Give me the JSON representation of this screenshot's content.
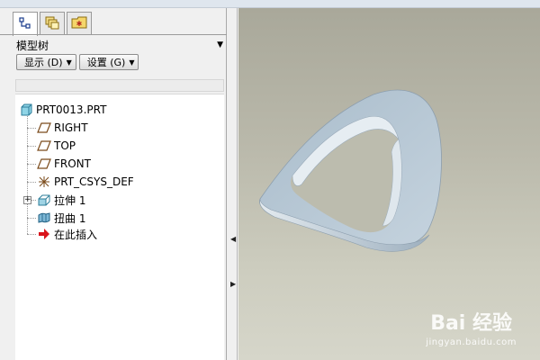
{
  "tabs": [
    {
      "icon": "model-tree-icon",
      "active": true
    },
    {
      "icon": "layers-icon",
      "active": false
    },
    {
      "icon": "favorites-folder-icon",
      "active": false
    }
  ],
  "panel": {
    "title": "模型树",
    "buttons": {
      "show": "显示 (D)",
      "settings": "设置 (G)"
    }
  },
  "tree": {
    "items": [
      {
        "label": "PRT0013.PRT",
        "icon": "part-icon"
      },
      {
        "label": "RIGHT",
        "icon": "datum-plane-icon"
      },
      {
        "label": "TOP",
        "icon": "datum-plane-icon"
      },
      {
        "label": "FRONT",
        "icon": "datum-plane-icon"
      },
      {
        "label": "PRT_CSYS_DEF",
        "icon": "coordinate-system-icon"
      },
      {
        "label": "拉伸 1",
        "icon": "extrude-icon",
        "expandable": true
      },
      {
        "label": "扭曲 1",
        "icon": "warp-icon"
      },
      {
        "label": "在此插入",
        "icon": "insert-here-arrow-icon"
      }
    ]
  },
  "watermark": {
    "brand": "Bai 经验",
    "url": "jingyan.baidu.com"
  },
  "colors": {
    "model_surface": "#b9c9d5",
    "viewport_top": "#a9a89a",
    "viewport_bottom": "#d6d6ca",
    "insert_arrow": "#d9141b"
  }
}
